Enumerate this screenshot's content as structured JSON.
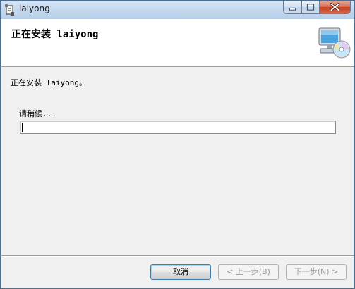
{
  "window": {
    "title": "laiyong",
    "controls": {
      "minimize": "minimize-icon",
      "maximize": "maximize-icon",
      "close": "close-icon"
    }
  },
  "banner": {
    "title": "正在安装 laiyong",
    "icon": "computer-cd-icon"
  },
  "content": {
    "status_text": "正在安装 laiyong。",
    "wait_label": "请稍候...",
    "progress_percent": 0
  },
  "buttons": {
    "cancel": "取消",
    "back": "< 上一步(B)",
    "next": "下一步(N) >"
  },
  "colors": {
    "window_bg": "#f0f0f0",
    "banner_bg": "#ffffff",
    "close_button": "#c3401f",
    "focus_border": "#3c7fb1"
  }
}
